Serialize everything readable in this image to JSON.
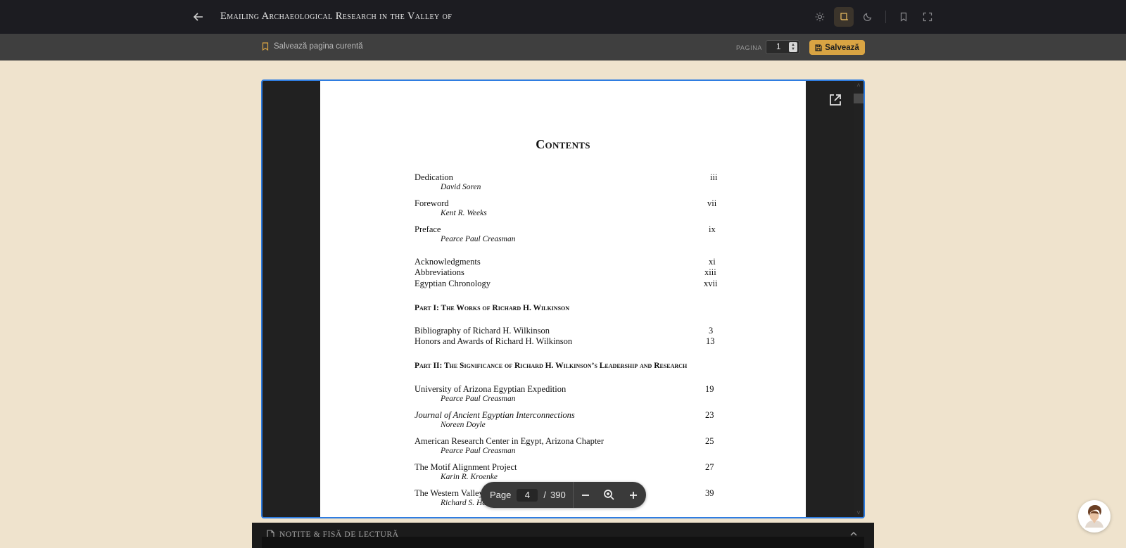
{
  "header": {
    "title": "Emailing Archaeological Research in the Valley of",
    "icons": [
      "arrow-left-icon",
      "sun-icon",
      "scroll-icon",
      "moon-icon",
      "bookmark-icon",
      "fullscreen-icon"
    ]
  },
  "subbar": {
    "save_current_label": "Salvează pagina curentă",
    "page_label": "PAGINA",
    "page_value": "1",
    "save_button_label": "Salvează"
  },
  "document": {
    "title": "Contents",
    "entries": [
      {
        "title": "Dedication",
        "author": "David Soren",
        "page": "iii"
      },
      {
        "title": "Foreword",
        "author": "Kent R. Weeks",
        "page": "vii"
      },
      {
        "title": "Preface",
        "author": "Pearce Paul Creasman",
        "page": "ix"
      },
      {
        "title": "Acknowledgments",
        "page": "xi"
      },
      {
        "title": "Abbreviations",
        "page": "xiii"
      },
      {
        "title": "Egyptian Chronology",
        "page": "xvii"
      }
    ],
    "part1": {
      "heading": "Part I: The Works of Richard H. Wilkinson",
      "entries": [
        {
          "title": "Bibliography of Richard H. Wilkinson",
          "page": "3"
        },
        {
          "title": "Honors and Awards of Richard H. Wilkinson",
          "page": "13"
        }
      ]
    },
    "part2": {
      "heading": "Part II: The Significance of Richard H. Wilkinson’s Leadership and Research",
      "entries": [
        {
          "title": "University of Arizona Egyptian Expedition",
          "author": "Pearce Paul Creasman",
          "page": "19"
        },
        {
          "title": "Journal of Ancient Egyptian Interconnections",
          "author": "Noreen Doyle",
          "page": "23"
        },
        {
          "title": "American Research Center in Egypt, Arizona Chapter",
          "author": "Pearce Paul Creasman",
          "page": "25"
        },
        {
          "title": "The Motif Alignment Project",
          "author": "Karin R. Kroenke",
          "page": "27"
        },
        {
          "title": "The Western Valley of the Kings Project",
          "author": "Richard S. Harwood",
          "page": "39"
        }
      ]
    }
  },
  "page_nav": {
    "label": "Page",
    "current": "4",
    "separator": "/",
    "total": "390"
  },
  "notes": {
    "label": "NOTIȚE & FIȘĂ DE LECTURĂ"
  },
  "colors": {
    "accent": "#d9a443",
    "selection_border": "#2f7de1",
    "background": "#efe3cd"
  }
}
